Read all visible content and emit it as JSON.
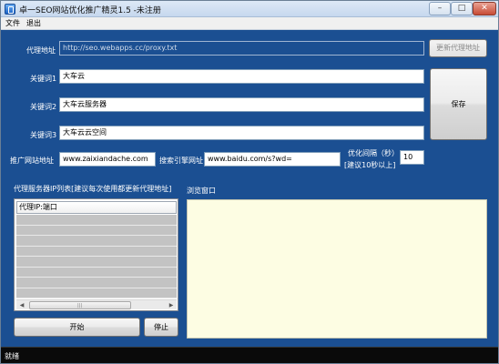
{
  "window": {
    "title": "卓一SEO网站优化推广精灵1.5 -未注册"
  },
  "menu": {
    "file": "文件",
    "exit": "退出"
  },
  "proxy_address": {
    "label": "代理地址",
    "value": "http://seo.webapps.cc/proxy.txt",
    "update_button": "更新代理地址"
  },
  "keywords": [
    {
      "label": "关键词1",
      "value": "大车云"
    },
    {
      "label": "关键词2",
      "value": "大车云服务器"
    },
    {
      "label": "关键词3",
      "value": "大车云云空间"
    }
  ],
  "save_button": "保存",
  "promo_site": {
    "label": "推广网站地址",
    "value": "www.zaixiandache.com"
  },
  "search_engine": {
    "label": "搜索引擎网址",
    "value": "www.baidu.com/s?wd="
  },
  "interval": {
    "label_line1": "优化间隔（秒）",
    "label_line2": "[建议10秒以上]",
    "value": "10"
  },
  "proxy_list": {
    "label": "代理服务器IP列表[建议每次使用都更新代理地址]",
    "column_header": "代理IP:端口"
  },
  "browser": {
    "label": "浏览窗口"
  },
  "start_button": "开始",
  "stop_button": "停止",
  "status": {
    "text": "就绪"
  }
}
